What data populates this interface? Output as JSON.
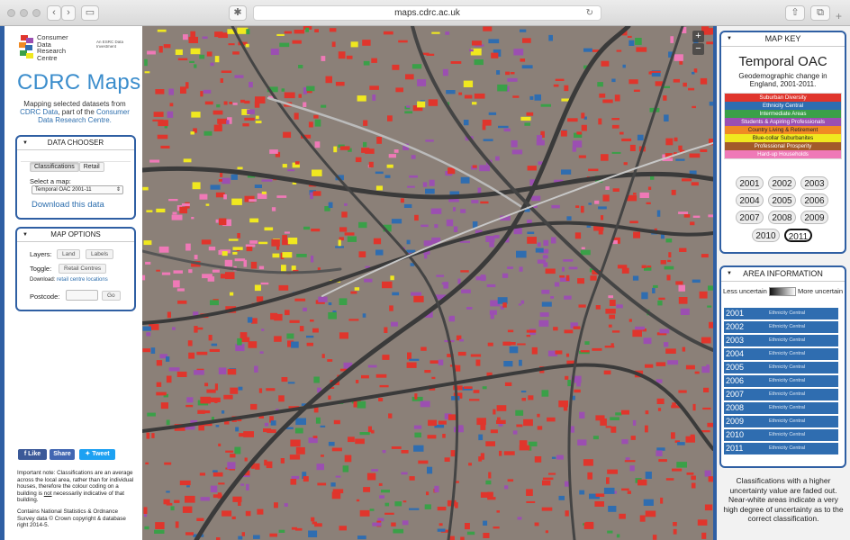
{
  "browser": {
    "url": "maps.cdrc.ac.uk"
  },
  "sidebar": {
    "logo_lines": [
      "Consumer",
      "Data",
      "Research",
      "Centre"
    ],
    "esrc_text": "An ESRC Data Investment",
    "title": "CDRC Maps",
    "tagline_prefix": "Mapping selected datasets from",
    "tagline_link1": "CDRC Data",
    "tagline_mid": ", part of the",
    "tagline_link2": "Consumer Data Research Centre.",
    "data_chooser": {
      "header": "DATA CHOOSER",
      "tabs": [
        "Classifications",
        "Retail"
      ],
      "select_label": "Select a map:",
      "selected_map": "Temporal OAC 2001-11",
      "download_link": "Download this data"
    },
    "map_options": {
      "header": "MAP OPTIONS",
      "layers_label": "Layers:",
      "layer_buttons": [
        "Land",
        "Labels"
      ],
      "toggle_label": "Toggle:",
      "toggle_button": "Retail Centres",
      "download_label": "Download:",
      "download_link": "retail centre locations",
      "postcode_label": "Postcode:",
      "postcode_value": "",
      "go_button": "Go"
    },
    "social": {
      "like": "Like",
      "share": "Share",
      "tweet": "Tweet"
    },
    "note_part1": "Important note: Classifications are an average across the local area, rather than for individual houses, therefore the colour coding on a building is ",
    "note_not": "not",
    "note_part2": " necessarily indicative of that building.",
    "copyright": "Contains National Statistics & Ordnance Survey data © Crown copyright & database right 2014-5."
  },
  "map": {
    "zoom_in": "+",
    "zoom_out": "−"
  },
  "map_key": {
    "header": "MAP KEY",
    "title": "Temporal OAC",
    "subtitle": "Geodemographic change in England, 2001-2011.",
    "legend": [
      {
        "label": "Suburban Diversity",
        "color": "#e0352c"
      },
      {
        "label": "Ethnicity Central",
        "color": "#2f6db0"
      },
      {
        "label": "Intermediate Areas",
        "color": "#3aa048"
      },
      {
        "label": "Students & Aspiring Professionals",
        "color": "#9b4fb1"
      },
      {
        "label": "Country Living & Retirement",
        "color": "#f08a24"
      },
      {
        "label": "Blue-collar Suburbanites",
        "color": "#f0e81f"
      },
      {
        "label": "Professional Prosperity",
        "color": "#a25a2a"
      },
      {
        "label": "Hard-up Households",
        "color": "#ef79b7"
      }
    ],
    "years": [
      "2001",
      "2002",
      "2003",
      "2004",
      "2005",
      "2006",
      "2007",
      "2008",
      "2009",
      "2010",
      "2011"
    ],
    "selected_year": "2011"
  },
  "area_info": {
    "header": "AREA INFORMATION",
    "uncertainty_left": "Less uncertain",
    "uncertainty_right": "More uncertain",
    "rows": [
      {
        "year": "2001",
        "class": "Ethnicity Central"
      },
      {
        "year": "2002",
        "class": "Ethnicity Central"
      },
      {
        "year": "2003",
        "class": "Ethnicity Central"
      },
      {
        "year": "2004",
        "class": "Ethnicity Central"
      },
      {
        "year": "2005",
        "class": "Ethnicity Central"
      },
      {
        "year": "2006",
        "class": "Ethnicity Central"
      },
      {
        "year": "2007",
        "class": "Ethnicity Central"
      },
      {
        "year": "2008",
        "class": "Ethnicity Central"
      },
      {
        "year": "2009",
        "class": "Ethnicity Central"
      },
      {
        "year": "2010",
        "class": "Ethnicity Central"
      },
      {
        "year": "2011",
        "class": "Ethnicity Central"
      }
    ],
    "footnote": "Classifications with a higher uncertainty value are faded out. Near-white areas indicate a very high degree of uncertainty as to the correct classification."
  }
}
